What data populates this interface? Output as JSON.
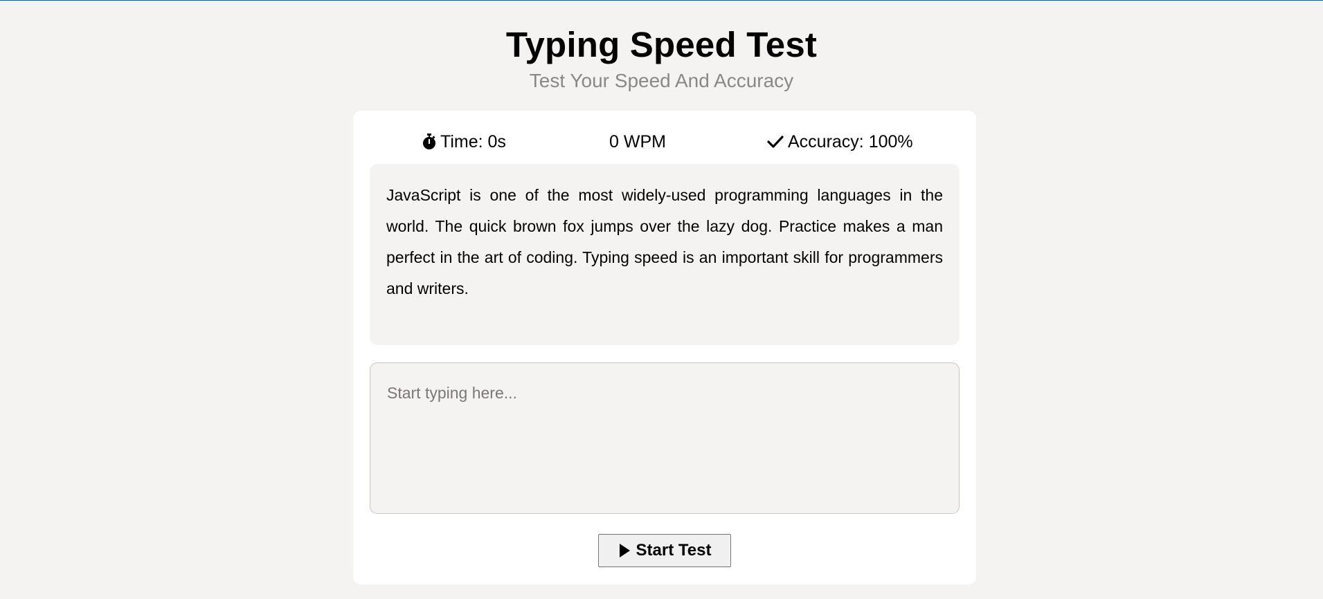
{
  "header": {
    "title": "Typing Speed Test",
    "subtitle": "Test Your Speed And Accuracy"
  },
  "stats": {
    "time_label": "Time: 0s",
    "time_icon": "stopwatch-icon",
    "wpm_label": "0 WPM",
    "accuracy_label": "Accuracy: 100%",
    "accuracy_icon": "checkmark-icon"
  },
  "passage": {
    "text": "JavaScript is one of the most widely-used programming languages in the world. The quick brown fox jumps over the lazy dog. Practice makes a man perfect in the art of coding. Typing speed is an important skill for programmers and writers."
  },
  "input": {
    "placeholder": "Start typing here...",
    "value": ""
  },
  "button": {
    "label": "Start Test",
    "icon": "play-icon"
  },
  "colors": {
    "page_background": "#f5f2f2",
    "card_background": "#ffffff",
    "top_border": "#1f5f8b",
    "subtitle": "#8a8787"
  }
}
